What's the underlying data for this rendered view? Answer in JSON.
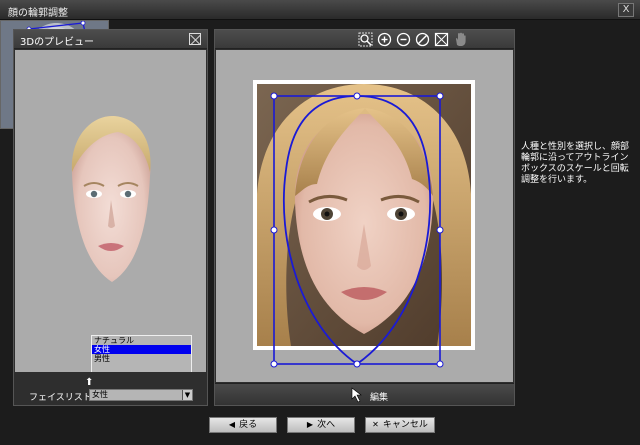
{
  "window": {
    "title": "顔の輪郭調整",
    "close_label": "X"
  },
  "preview_panel": {
    "title": "3Dのプレビュー",
    "list_label": "フェイスリスト",
    "face_options": [
      "ナチュラル",
      "女性",
      "男性"
    ],
    "selected_face": "女性"
  },
  "edit_panel": {
    "tools": [
      "zoom-fit-icon",
      "zoom-in-icon",
      "zoom-out-icon",
      "reset-icon",
      "fit-icon",
      "pan-hand-icon"
    ],
    "status_label": "編集"
  },
  "help": {
    "text": "人種と性別を選択し、顔部輪郭に沿ってアウトラインボックスのスケールと回転調整を行います。"
  },
  "buttons": {
    "back": "戻る",
    "next": "次へ",
    "cancel": "キャンセル"
  }
}
